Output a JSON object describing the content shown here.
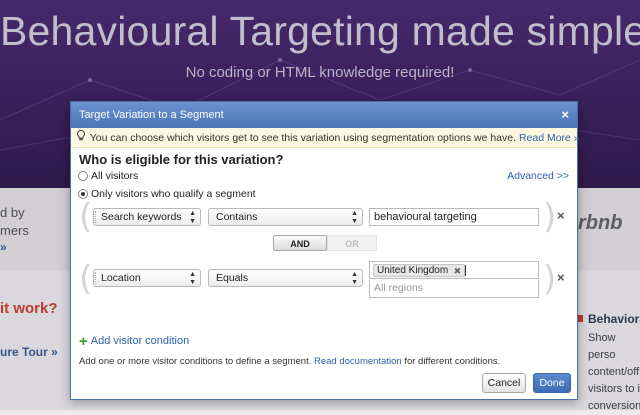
{
  "background": {
    "hero_title": "Behavioural Targeting made simple!",
    "hero_subtitle": "No coding or HTML knowledge required!",
    "left_text_line1": "d by",
    "left_text_line2": "mers",
    "left_link": "»",
    "left_logo": "",
    "question_text": "it work?",
    "tour_link": "ure Tour »",
    "right_logo": "rbnb",
    "right_title": "Behaviora",
    "right_text": [
      "Show perso",
      "content/off",
      "visitors to i",
      "conversion"
    ]
  },
  "modal": {
    "title": "Target Variation to a Segment",
    "close_label": "×",
    "info_text": "You can choose which visitors get to see this variation using segmentation options we have.",
    "info_link": "Read More »",
    "question": "Who is eligible for this variation?",
    "radio_all": "All visitors",
    "radio_segment": "Only visitors who qualify a segment",
    "advanced_link": "Advanced >>",
    "conditions": [
      {
        "field": "Search keywords",
        "operator": "Contains",
        "value": "behavioural targeting"
      },
      {
        "field": "Location",
        "operator": "Equals",
        "tag": "United Kingdom",
        "placeholder": "All regions"
      }
    ],
    "and_label": "AND",
    "or_label": "OR",
    "add_condition": "Add visitor condition",
    "help_text_before": "Add one or more visitor conditions to define a segment.",
    "help_link": "Read documentation",
    "help_text_after": "for different conditions.",
    "cancel_label": "Cancel",
    "done_label": "Done"
  },
  "colors": {
    "header_blue": "#4a76b8",
    "link_blue": "#2c62a8",
    "done_blue": "#3c6bb5",
    "hero_purple": "#3b1f5e",
    "info_yellow": "#fbf7e1",
    "plus_green": "#3a9a2a"
  }
}
